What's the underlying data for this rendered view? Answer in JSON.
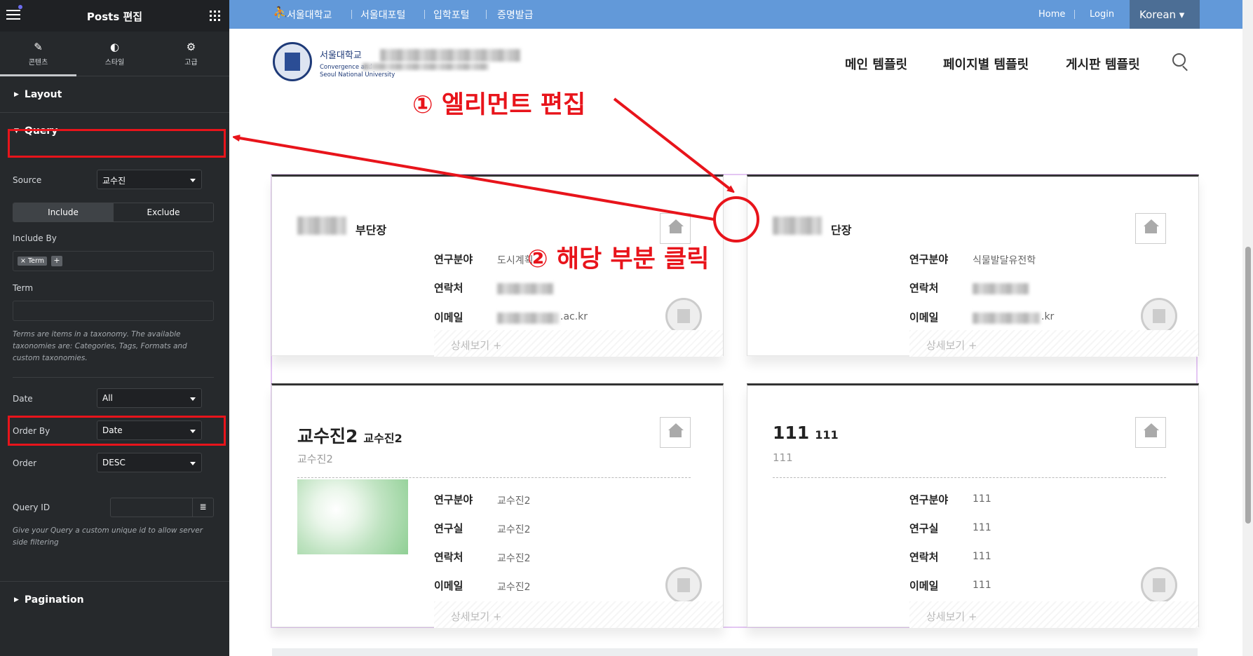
{
  "panel": {
    "title": "Posts 편집",
    "tabs": [
      {
        "label": "콘텐츠",
        "icon": "pencil-icon"
      },
      {
        "label": "스타일",
        "icon": "contrast-icon"
      },
      {
        "label": "고급",
        "icon": "gear-icon"
      }
    ],
    "sections": {
      "layout": "Layout",
      "query": "Query",
      "pagination": "Pagination"
    },
    "source_label": "Source",
    "source_value": "교수진",
    "include_label": "Include",
    "exclude_label": "Exclude",
    "include_by_label": "Include By",
    "term_tag": "× Term",
    "plus": "+",
    "term_label": "Term",
    "term_help": "Terms are items in a taxonomy. The available taxonomies are: Categories, Tags, Formats and custom taxonomies.",
    "date_label": "Date",
    "date_value": "All",
    "orderby_label": "Order By",
    "orderby_value": "Date",
    "order_label": "Order",
    "order_value": "DESC",
    "queryid_label": "Query ID",
    "queryid_help": "Give your Query a custom unique id to allow server side filtering",
    "collapse": "‹"
  },
  "site": {
    "topbar": {
      "links": [
        "서울대학교",
        "서울대포털",
        "입학포털",
        "증명발급"
      ],
      "home": "Home",
      "login": "Login",
      "language": "Korean ▾"
    },
    "logo_text": {
      "title": "서울대학교",
      "line1": "Convergence and",
      "line2": "Seoul National University"
    },
    "menu": [
      "메인 템플릿",
      "페이지별 템플릿",
      "게시판 템플릿"
    ],
    "cards": [
      {
        "title": "부단장",
        "fields": [
          [
            "연구분야",
            "도시계획"
          ],
          [
            "연락처",
            ""
          ],
          [
            "이메일",
            ".ac.kr"
          ]
        ],
        "more": "상세보기  +"
      },
      {
        "title": "단장",
        "fields": [
          [
            "연구분야",
            "식물발달유전학"
          ],
          [
            "연락처",
            ""
          ],
          [
            "이메일",
            ".kr"
          ]
        ],
        "more": "상세보기  +"
      },
      {
        "title": "교수진2",
        "sub": "교수진2",
        "subtitle": "교수진2",
        "fields": [
          [
            "연구분야",
            "교수진2"
          ],
          [
            "연구실",
            "교수진2"
          ],
          [
            "연락처",
            "교수진2"
          ],
          [
            "이메일",
            "교수진2"
          ]
        ],
        "more": "상세보기  +"
      },
      {
        "title": "111",
        "sub": "111",
        "subtitle": "111",
        "fields": [
          [
            "연구분야",
            "111"
          ],
          [
            "연구실",
            "111"
          ],
          [
            "연락처",
            "111"
          ],
          [
            "이메일",
            "111"
          ]
        ],
        "more": "상세보기  +"
      }
    ]
  },
  "annotations": {
    "step1": "① 엘리먼트 편집",
    "step2": "② 해당 부분 클릭"
  },
  "colors": {
    "highlight": "#e8141b",
    "topbar": "#6299d9",
    "panel": "#26292c"
  }
}
